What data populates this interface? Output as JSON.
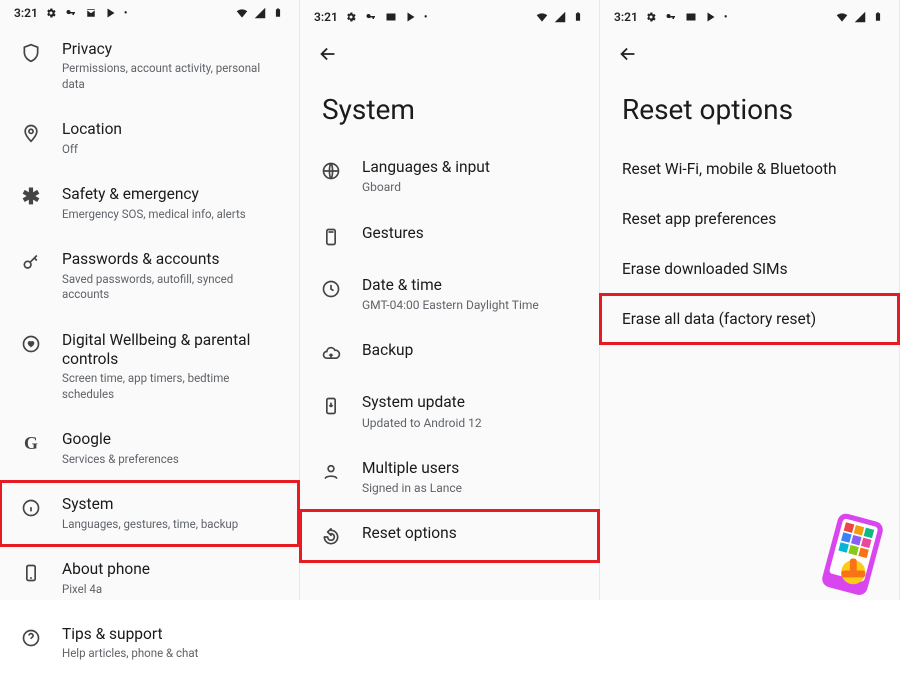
{
  "status": {
    "time": "3:21",
    "icons_left": [
      "gear",
      "key",
      "mail",
      "play",
      "dot"
    ],
    "icons_right": [
      "wifi",
      "signal",
      "battery"
    ]
  },
  "pane1": {
    "items": [
      {
        "icon": "shield",
        "title": "Privacy",
        "sub": "Permissions, account activity, personal data",
        "hl": false
      },
      {
        "icon": "pin",
        "title": "Location",
        "sub": "Off",
        "hl": false
      },
      {
        "icon": "asterisk",
        "title": "Safety & emergency",
        "sub": "Emergency SOS, medical info, alerts",
        "hl": false
      },
      {
        "icon": "key",
        "title": "Passwords & accounts",
        "sub": "Saved passwords, autofill, synced accounts",
        "hl": false
      },
      {
        "icon": "heart",
        "title": "Digital Wellbeing & parental controls",
        "sub": "Screen time, app timers, bedtime schedules",
        "hl": false
      },
      {
        "icon": "g",
        "title": "Google",
        "sub": "Services & preferences",
        "hl": false
      },
      {
        "icon": "info",
        "title": "System",
        "sub": "Languages, gestures, time, backup",
        "hl": true
      },
      {
        "icon": "phone",
        "title": "About phone",
        "sub": "Pixel 4a",
        "hl": false
      },
      {
        "icon": "help",
        "title": "Tips & support",
        "sub": "Help articles, phone & chat",
        "hl": false
      }
    ]
  },
  "pane2": {
    "title": "System",
    "items": [
      {
        "icon": "globe",
        "title": "Languages & input",
        "sub": "Gboard",
        "hl": false
      },
      {
        "icon": "gesture",
        "title": "Gestures",
        "sub": "",
        "hl": false
      },
      {
        "icon": "clock",
        "title": "Date & time",
        "sub": "GMT-04:00 Eastern Daylight Time",
        "hl": false
      },
      {
        "icon": "cloud",
        "title": "Backup",
        "sub": "",
        "hl": false
      },
      {
        "icon": "update",
        "title": "System update",
        "sub": "Updated to Android 12",
        "hl": false
      },
      {
        "icon": "users",
        "title": "Multiple users",
        "sub": "Signed in as Lance",
        "hl": false
      },
      {
        "icon": "reset",
        "title": "Reset options",
        "sub": "",
        "hl": true
      }
    ]
  },
  "pane3": {
    "title": "Reset options",
    "items": [
      {
        "title": "Reset Wi-Fi, mobile & Bluetooth",
        "hl": false
      },
      {
        "title": "Reset app preferences",
        "hl": false
      },
      {
        "title": "Erase downloaded SIMs",
        "hl": false
      },
      {
        "title": "Erase all data (factory reset)",
        "hl": true
      }
    ]
  }
}
